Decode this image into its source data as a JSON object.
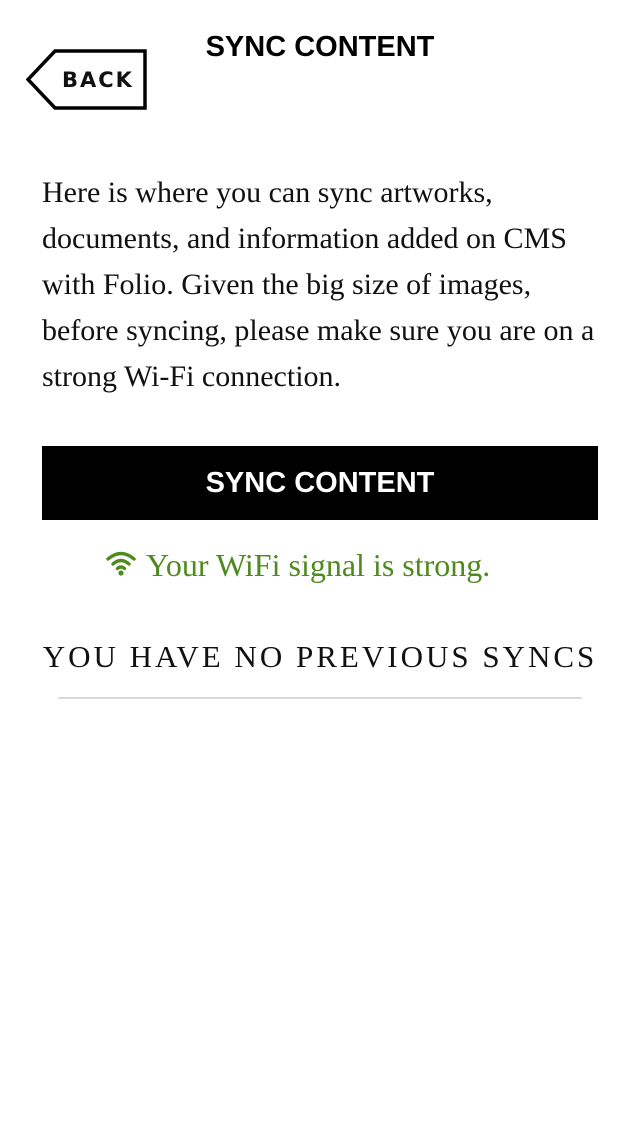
{
  "header": {
    "back_label": "BACK",
    "title": "SYNC CONTENT"
  },
  "main": {
    "description": "Here is where you can sync artworks, documents, and information added on CMS with Folio. Given the big size of images, before syncing, please make sure you are on a strong Wi-Fi connection.",
    "sync_button_label": "SYNC CONTENT",
    "wifi_status": {
      "icon": "wifi-icon",
      "text": "Your WiFi signal is strong.",
      "color": "#4e8a1d"
    },
    "history_heading": "YOU HAVE NO PREVIOUS SYNCS"
  },
  "colors": {
    "primary_button": "#000000",
    "divider": "#d9d9d9",
    "status_ok": "#4e8a1d"
  }
}
